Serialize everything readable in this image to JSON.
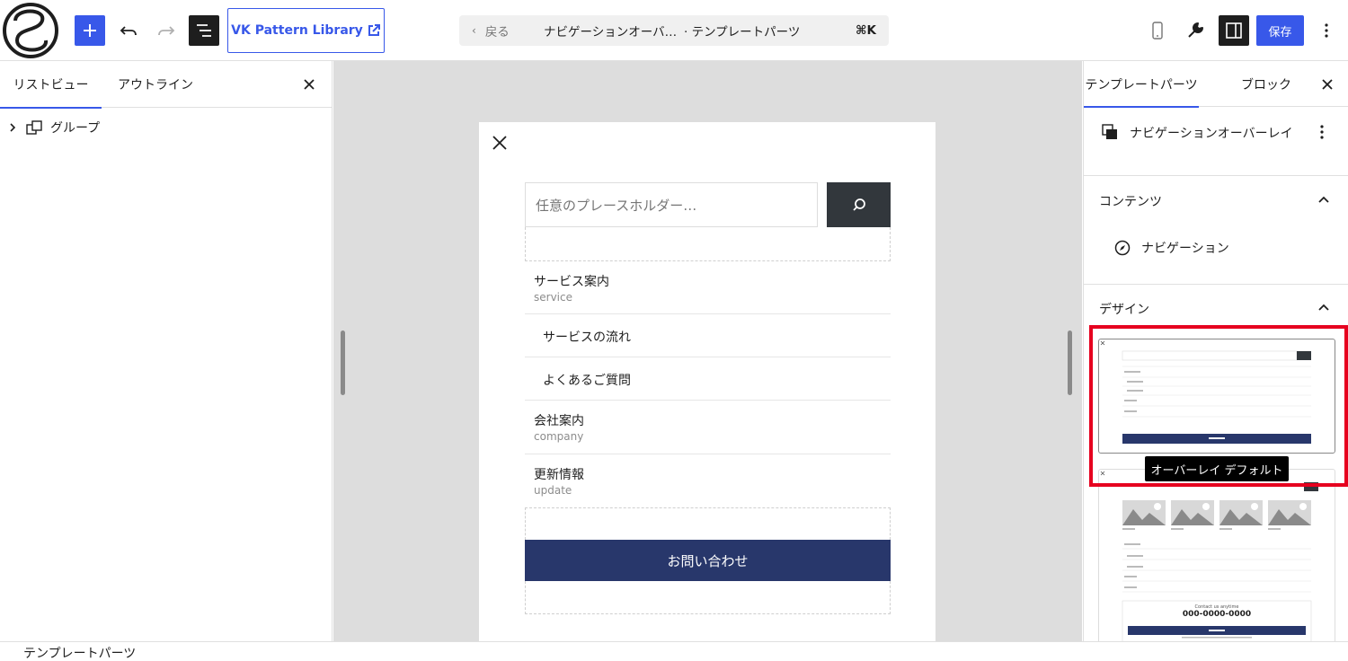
{
  "toolbar": {
    "vk_button_label": "VK Pattern Library",
    "save_label": "保存"
  },
  "command_bar": {
    "back_label": "戻る",
    "title": "ナビゲーションオーバ…",
    "type": "· テンプレートパーツ",
    "shortcut": "⌘K"
  },
  "list_view": {
    "tabs": [
      "リストビュー",
      "アウトライン"
    ],
    "items": [
      {
        "label": "グループ"
      }
    ]
  },
  "canvas": {
    "search_placeholder": "任意のプレースホルダー…",
    "nav": [
      {
        "label": "サービス案内",
        "sub": "service"
      },
      {
        "label": "サービスの流れ",
        "sub": ""
      },
      {
        "label": "よくあるご質問",
        "sub": ""
      },
      {
        "label": "会社案内",
        "sub": "company"
      },
      {
        "label": "更新情報",
        "sub": "update"
      }
    ],
    "contact_button": "お問い合わせ"
  },
  "sidebar": {
    "tabs": [
      "テンプレートパーツ",
      "ブロック"
    ],
    "block_title": "ナビゲーションオーバーレイ",
    "content_heading": "コンテンツ",
    "navigation_label": "ナビゲーション",
    "design_heading": "デザイン",
    "tooltip": "オーバーレイ デフォルト",
    "thumbnail_2": {
      "phone": "000-0000-0000",
      "small_texts": [
        "Contact us anytime"
      ]
    }
  },
  "footer": {
    "breadcrumb": "テンプレートパーツ"
  },
  "colors": {
    "accent": "#3858e9",
    "contact_button": "#28376b",
    "search_button": "#32373c",
    "highlight": "#e6001f"
  }
}
